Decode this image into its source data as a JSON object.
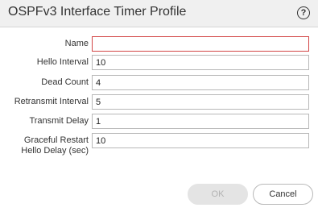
{
  "dialog": {
    "title": "OSPFv3 Interface Timer Profile",
    "help_icon": "question-circle-icon"
  },
  "fields": {
    "name": {
      "label": "Name",
      "value": ""
    },
    "hello_interval": {
      "label": "Hello Interval",
      "value": "10"
    },
    "dead_count": {
      "label": "Dead Count",
      "value": "4"
    },
    "retransmit_interval": {
      "label": "Retransmit Interval",
      "value": "5"
    },
    "transmit_delay": {
      "label": "Transmit Delay",
      "value": "1"
    },
    "graceful_restart": {
      "label_line1": "Graceful Restart",
      "label_line2": "Hello Delay (sec)",
      "value": "10"
    }
  },
  "buttons": {
    "ok": "OK",
    "cancel": "Cancel"
  },
  "colors": {
    "titlebar_bg": "#f0f0f0",
    "invalid_border": "#d24545",
    "disabled_button_bg": "#e4e4e4"
  }
}
